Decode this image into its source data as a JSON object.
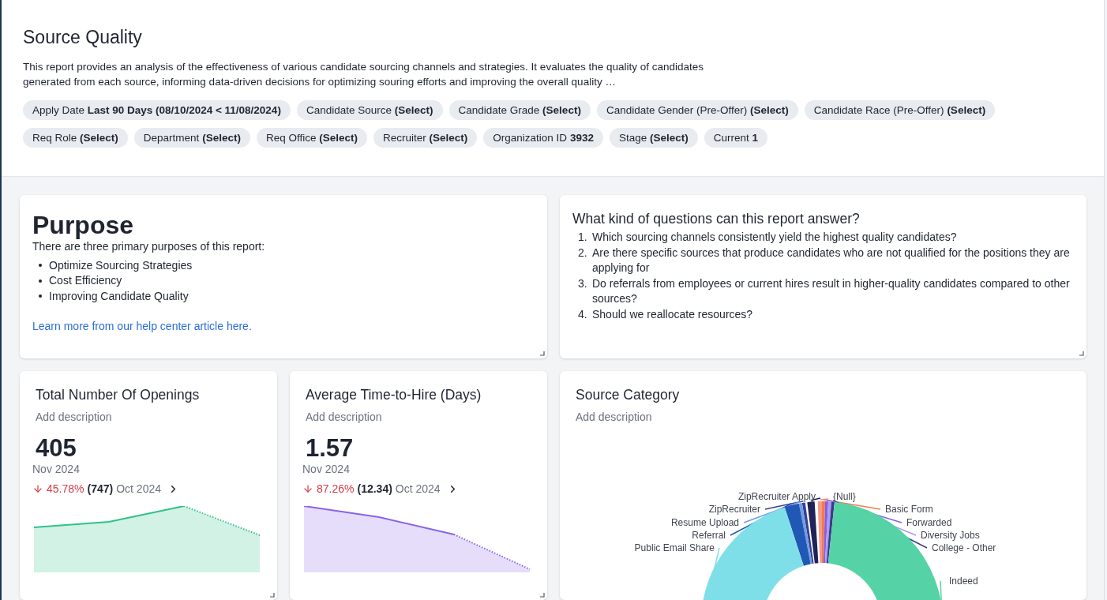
{
  "report": {
    "title": "Source Quality",
    "description": "This report provides an analysis of the effectiveness of various candidate sourcing channels and strategies. It evaluates the quality of candidates generated from each source, informing data-driven decisions for optimizing souring efforts and improving the overall quality …"
  },
  "filters": [
    {
      "label": "Apply Date",
      "value": "Last 90 Days (08/10/2024 < 11/08/2024)"
    },
    {
      "label": "Candidate Source",
      "value": "(Select)"
    },
    {
      "label": "Candidate Grade",
      "value": "(Select)"
    },
    {
      "label": "Candidate Gender (Pre-Offer)",
      "value": "(Select)"
    },
    {
      "label": "Candidate Race (Pre-Offer)",
      "value": "(Select)"
    },
    {
      "label": "Req Role",
      "value": "(Select)"
    },
    {
      "label": "Department",
      "value": "(Select)"
    },
    {
      "label": "Req Office",
      "value": "(Select)"
    },
    {
      "label": "Recruiter",
      "value": "(Select)"
    },
    {
      "label": "Organization ID",
      "value": "3932"
    },
    {
      "label": "Stage",
      "value": "(Select)"
    },
    {
      "label": "Current",
      "value": "1"
    }
  ],
  "purpose": {
    "title": "Purpose",
    "intro": "There are three primary purposes of this report:",
    "items": [
      "Optimize Sourcing Strategies",
      "Cost Efficiency",
      "Improving Candidate Quality"
    ],
    "link": "Learn more from our help center article here."
  },
  "questions": {
    "title": "What kind of questions can this report answer?",
    "items": [
      {
        "number": "1.",
        "text": "Which sourcing channels consistently yield the highest quality candidates?"
      },
      {
        "number": "2.",
        "text": "Are there specific sources that produce candidates who are not qualified for the positions they are applying for"
      },
      {
        "number": "3.",
        "text": "Do referrals from employees or current hires result in higher-quality candidates compared to other sources?"
      },
      {
        "number": "4.",
        "text": "Should we reallocate resources?"
      }
    ]
  },
  "kpis": [
    {
      "title": "Total Number Of Openings",
      "description": "Add description",
      "value": "405",
      "period": "Nov 2024",
      "change": "45.78%",
      "previous_value": "(747)",
      "previous_period": "Oct 2024",
      "color": "#2fc28a"
    },
    {
      "title": "Average Time-to-Hire (Days)",
      "description": "Add description",
      "value": "1.57",
      "period": "Nov 2024",
      "change": "87.26%",
      "previous_value": "(12.34)",
      "previous_period": "Oct 2024",
      "color": "#8b63e8"
    }
  ],
  "source_category": {
    "title": "Source Category",
    "description": "Add description",
    "slices": [
      {
        "label": "ZipRecruiter Apply",
        "color": "#1e2457"
      },
      {
        "label": "{Null}",
        "color": "#f59a8a"
      },
      {
        "label": "ZipRecruiter",
        "color": "#3a3f8f"
      },
      {
        "label": "Basic Form",
        "color": "#f07c4a"
      },
      {
        "label": "Resume Upload",
        "color": "#6f9ee8"
      },
      {
        "label": "Forwarded",
        "color": "#8a5ce6"
      },
      {
        "label": "Referral",
        "color": "#2158b5"
      },
      {
        "label": "Diversity Jobs",
        "color": "#a89cf0"
      },
      {
        "label": "Public Email Share",
        "color": "#7fdfe8"
      },
      {
        "label": "College - Other",
        "color": "#3c3a8c"
      },
      {
        "label": "Indeed",
        "color": "#55d3a6"
      }
    ]
  }
}
